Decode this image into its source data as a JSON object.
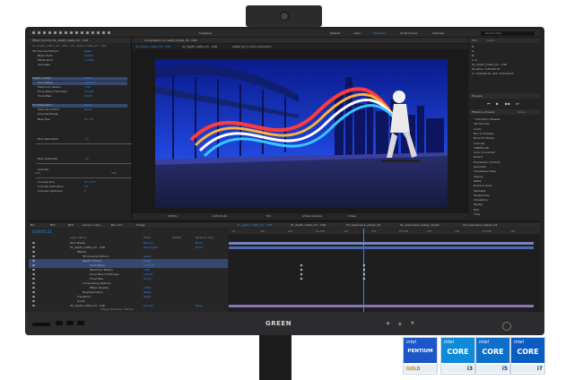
{
  "app": {
    "menu": [
      "Default",
      "Learn",
      "Standard",
      "Small Screen",
      "Libraries"
    ],
    "active_workspace": "Standard",
    "search_placeholder": "Search Help",
    "snapping_label": "Snapping"
  },
  "effect_controls": {
    "tab_label": "Effect Controls 01_depth_matte_04 - C4D",
    "layer_path": "01_depth_matte_04 - C4D > 01_depth_matte_03 - C4D",
    "rows": [
      {
        "name": "3D Channel Extract",
        "value": "Reset"
      },
      {
        "name": "Black Point",
        "value": "0.0014"
      },
      {
        "name": "White Point",
        "value": "0.2458"
      },
      {
        "name": "Anti-alias",
        "value": ""
      },
      {
        "name": "Depth of Field",
        "value": "Reset"
      },
      {
        "name": "Focal Plane",
        "value": "1213.76"
      },
      {
        "name": "Maximum Radius",
        "value": "3.00"
      },
      {
        "name": "Focal Plane Thickness",
        "value": "123.87"
      },
      {
        "name": "Focal Bias",
        "value": "50.93"
      },
      {
        "name": "Hue/Saturation",
        "value": "Reset"
      },
      {
        "name": "Channel Control",
        "value": "Blues"
      },
      {
        "name": "Channel Range",
        "value": ""
      },
      {
        "name": "Blue Hue",
        "value": "0x -12°"
      },
      {
        "name": "Blue Saturation",
        "value": "-17"
      },
      {
        "name": "Blue Lightness",
        "value": "-17"
      },
      {
        "name": "Colorize",
        "value": ""
      },
      {
        "name": "Colorize Hue",
        "value": "0x +0.0°"
      },
      {
        "name": "Colorize Saturation",
        "value": "25"
      },
      {
        "name": "Colorize Lightness",
        "value": "0"
      }
    ],
    "scale_min": "-100",
    "scale_max": "100"
  },
  "composition": {
    "tab_label": "Composition 01_depth_matte_04 - C4D",
    "viewer_tabs": [
      "01_depth_matte_04 - C4D",
      "01_depth_matte_03 - C4D",
      "skater girl to track animation"
    ],
    "zoom": "(100%)",
    "timecode": "0;00;01;21",
    "resolution": "Full",
    "camera": "Active Camera",
    "views": "1 View"
  },
  "right_panel": {
    "info_tab": "Info",
    "audio_tab": "Audio",
    "info_lines": [
      "R:",
      "G:",
      "B:",
      "A: 0",
      "01_depth_matte_03 - C4D",
      "Duration: 0;00;04;13",
      "In: 0;00;00;00, Out: 0;00;04;12"
    ],
    "preview_tab": "Preview",
    "effects_tab": "Effects & Presets",
    "library_tab": "Librari",
    "effects": [
      "* Animation Presets",
      "3D Channel",
      "Audio",
      "Blur & Sharpen",
      "Boris FX Mocha",
      "Channel",
      "CINEMA 4D",
      "Color Correction",
      "Distort",
      "Expression Controls",
      "Generate",
      "Immersive Video",
      "Keying",
      "Matte",
      "Noise & Grain",
      "Obsolete",
      "Perspective",
      "Simulation",
      "Stylize",
      "Text",
      "Time"
    ]
  },
  "timeline": {
    "tabs": [
      "01_depth_matte_04 - C4D",
      "01_depth_matte_03 - C4D",
      "03_responsive_design_02",
      "01_responsive_design_target",
      "03_responsive_design_02"
    ],
    "top_tabs": [
      "Bin",
      "Bk3",
      "Bk5",
      "Group 1 copy",
      "Bin color",
      "bridge"
    ],
    "timecode": "0;00;01;21",
    "column_layer_name": "Layer Name",
    "column_mode": "Mode",
    "column_trkmat": "TrkMat",
    "column_parent": "Parent & Link",
    "layers": [
      {
        "name": "Item Masks",
        "mode": "Normal",
        "parent": "None"
      },
      {
        "name": "01_depth_matte_03 - C4D",
        "mode": "Hard Light",
        "parent": "None"
      },
      {
        "name": "Effects",
        "mode": "",
        "parent": ""
      },
      {
        "name": "3D Channel Extract",
        "mode": "Reset",
        "parent": ""
      },
      {
        "name": "Depth of Field",
        "mode": "Reset",
        "parent": ""
      },
      {
        "name": "Focal Plane",
        "mode": "1213.76",
        "parent": ""
      },
      {
        "name": "Maximum Radius",
        "mode": "3.00",
        "parent": ""
      },
      {
        "name": "Focal Plane Thickness",
        "mode": "123.87",
        "parent": ""
      },
      {
        "name": "Focal Bias",
        "mode": "50.93",
        "parent": ""
      },
      {
        "name": "Compositing Options",
        "mode": "",
        "parent": ""
      },
      {
        "name": "Effect Opacity",
        "mode": "100%",
        "parent": ""
      },
      {
        "name": "Hue/Saturation",
        "mode": "Reset",
        "parent": ""
      },
      {
        "name": "Transform",
        "mode": "Reset",
        "parent": ""
      },
      {
        "name": "Audio",
        "mode": "",
        "parent": ""
      },
      {
        "name": "01_depth_matte_04 - C4D",
        "mode": "Normal",
        "parent": "None"
      }
    ],
    "ruler": [
      "0f",
      "10f",
      "20f",
      "01:00f",
      "10f",
      "20f",
      "02:00f",
      "10f",
      "20f",
      "03:00f",
      "10f"
    ],
    "toggle_label": "Toggle Switches / Modes"
  },
  "monitor": {
    "brand": "GREEN"
  },
  "badges": [
    {
      "word": "PENTIUM",
      "tier": "GOLD",
      "color": "#1d56c8"
    },
    {
      "word": "CORE",
      "tier": "i3",
      "color": "#0e8ad8"
    },
    {
      "word": "CORE",
      "tier": "i5",
      "color": "#0e6fc9"
    },
    {
      "word": "CORE",
      "tier": "i7",
      "color": "#0a5cc0"
    }
  ],
  "badge_brand": "intel"
}
